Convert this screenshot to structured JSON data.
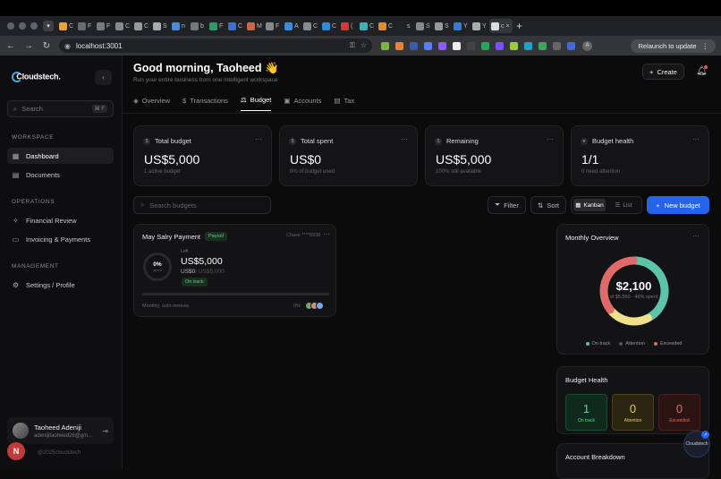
{
  "browser": {
    "tabs": [
      "C",
      "F",
      "F",
      "C",
      "C",
      "S",
      "n",
      "b",
      "F",
      "C",
      "M",
      "F",
      "A",
      "C",
      "C",
      "(",
      "C",
      "C",
      "s",
      "S",
      "S",
      "Y",
      "Y",
      "c"
    ],
    "active_tab": "c",
    "url": "localhost:3001",
    "relaunch_label": "Relaunch to update",
    "profile_initial": "A"
  },
  "sidebar": {
    "logo": "Cloudstech.",
    "search_placeholder": "Search",
    "search_shortcut": "⌘ F",
    "sections": [
      {
        "title": "WORKSPACE",
        "items": [
          "Dashboard",
          "Documents"
        ]
      },
      {
        "title": "OPERATIONS",
        "items": [
          "Financial Review",
          "Invoicing & Payments"
        ]
      },
      {
        "title": "MANAGEMENT",
        "items": [
          "Settings / Profile"
        ]
      }
    ],
    "user": {
      "name": "Taoheed Adeniji",
      "email": "adenijitaoheed26@gm..."
    },
    "copyright": "@2025cloudstech",
    "badge": "N"
  },
  "header": {
    "greeting": "Good morning, Taoheed 👋",
    "subtitle": "Run your entire business from one intelligent workspace",
    "create_label": "Create"
  },
  "tabs": [
    "Overview",
    "Transactions",
    "Budget",
    "Accounts",
    "Tax"
  ],
  "active_tab": "Budget",
  "kpis": [
    {
      "title": "Total budget",
      "value": "US$5,000",
      "sub": "1 active budget"
    },
    {
      "title": "Total spent",
      "value": "US$0",
      "sub": "0% of budget used"
    },
    {
      "title": "Remaining",
      "value": "US$5,000",
      "sub": "100% still available"
    },
    {
      "title": "Budget health",
      "value": "1/1",
      "sub": "0 need attention"
    }
  ],
  "toolbar": {
    "search_placeholder": "Search budgets",
    "filter": "Filter",
    "sort": "Sort",
    "kanban": "Kanban",
    "list": "List",
    "new_budget": "New budget"
  },
  "budget_card": {
    "title": "May Salry Payment",
    "tag": "Payroll",
    "client": "Chase ****8938",
    "percent": "0%",
    "ring_label": "spent",
    "left_label": "Left",
    "amount": "US$5,000",
    "spent": "US$0",
    "of_total": "/ US$5,000",
    "status": "On track",
    "footer": "Monthly, auto-renews",
    "footer_pct": "0%",
    "progress": 0
  },
  "overview": {
    "title": "Monthly Overview",
    "value": "$2,100",
    "sub": "of $5,550 · 46% spent",
    "segments": [
      {
        "name": "On track",
        "value": 42,
        "color": "#5ec4a8"
      },
      {
        "name": "Attention",
        "value": 22,
        "color": "#f0e08a"
      },
      {
        "name": "Exceeded",
        "value": 36,
        "color": "#e06a6a"
      }
    ]
  },
  "health": {
    "title": "Budget Health",
    "items": [
      {
        "n": "1",
        "label": "On track",
        "fg": "#5fd08a",
        "bg": "#0f2a1c",
        "bd": "#1f4a30"
      },
      {
        "n": "0",
        "label": "Attention",
        "fg": "#e8c96a",
        "bg": "#2a2612",
        "bd": "#4a4220"
      },
      {
        "n": "0",
        "label": "Exceeded",
        "fg": "#e06a6a",
        "bg": "#2a1414",
        "bd": "#4a2020"
      }
    ]
  },
  "breakdown": {
    "title": "Account Breakdown"
  },
  "chat": {
    "label": "Cloudstech"
  }
}
